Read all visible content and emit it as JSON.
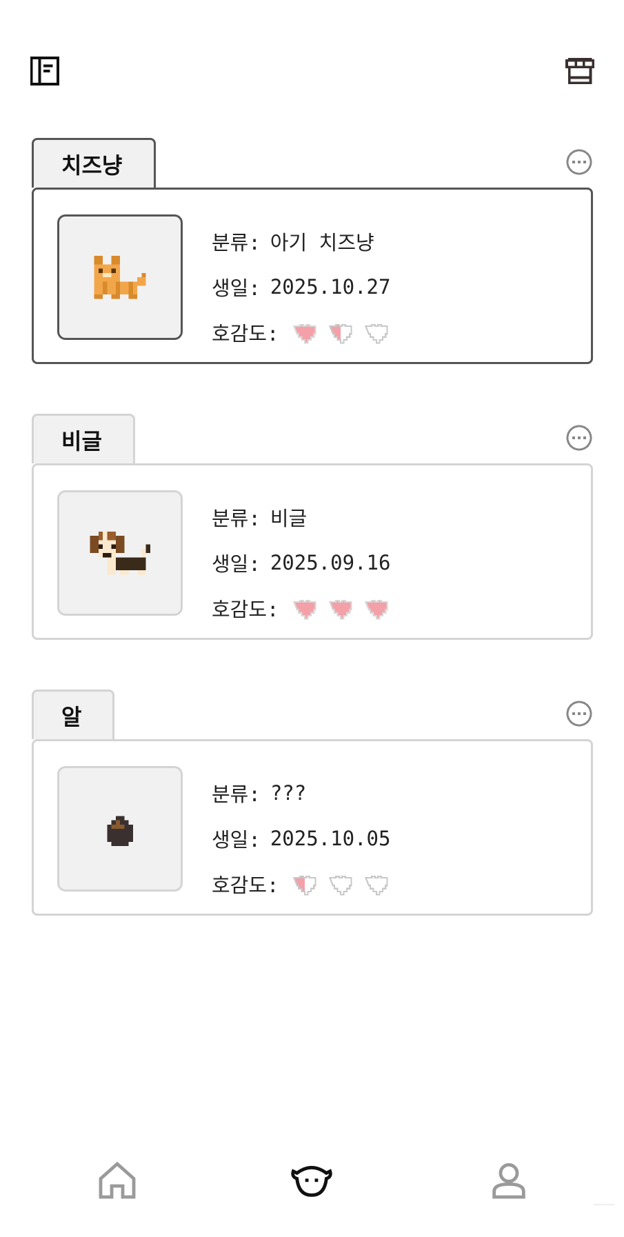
{
  "header": {
    "left_icon": "notebook-icon",
    "right_icon": "shop-icon"
  },
  "labels": {
    "category": "분류:",
    "birthday": "생일:",
    "affinity": "호감도:"
  },
  "colors": {
    "heart_fill": "#f4a0a8",
    "active_border": "#555555",
    "inactive_border": "#d4d4d4",
    "panel_bg": "#f1f1f1"
  },
  "pets": [
    {
      "name": "치즈냥",
      "category": "아기 치즈냥",
      "birthday": "2025.10.27",
      "affinity": 1.5,
      "affinity_max": 3,
      "sprite": "orange-kitten",
      "selected": true
    },
    {
      "name": "비글",
      "category": "비글",
      "birthday": "2025.09.16",
      "affinity": 3,
      "affinity_max": 3,
      "sprite": "beagle-puppy",
      "selected": false
    },
    {
      "name": "알",
      "category": "???",
      "birthday": "2025.10.05",
      "affinity": 0.5,
      "affinity_max": 3,
      "sprite": "egg",
      "selected": false
    }
  ],
  "nav": {
    "items": [
      {
        "icon": "home-icon",
        "active": false
      },
      {
        "icon": "pet-face-icon",
        "active": true
      },
      {
        "icon": "profile-icon",
        "active": false
      }
    ]
  }
}
